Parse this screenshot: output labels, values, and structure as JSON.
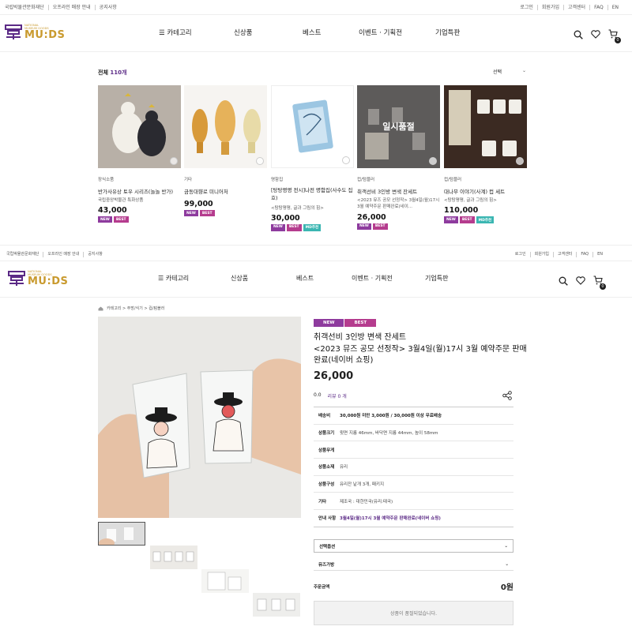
{
  "top": {
    "util_left": [
      "국립박물관문화재단",
      "오프라인 매장 안내",
      "공지사항"
    ],
    "util_right": [
      "로그인",
      "회원가입",
      "고객센터",
      "FAQ",
      "EN"
    ],
    "logo_small": [
      "NATIONAL",
      "MUSEUM GOODS"
    ],
    "logo_big": "MU:DS",
    "nav": [
      "카테고리",
      "신상품",
      "베스트",
      "이벤트 · 기획전",
      "기업특판"
    ],
    "cart_count": "0"
  },
  "listing": {
    "total_prefix": "전체",
    "total_count": "110개",
    "sort_label": "선택",
    "soldout_overlay": "일시품절",
    "products": [
      {
        "category": "장식소품",
        "name": "반가사유상 토우 시리즈(놀놀 반가)",
        "sub": "국립중앙박물관 특화상품",
        "price": "43,000",
        "tags": [
          "NEW",
          "BEST"
        ]
      },
      {
        "category": "기타",
        "name": "금동대향로 미니어처",
        "sub": "",
        "price": "99,000",
        "tags": [
          "NEW",
          "BEST"
        ]
      },
      {
        "category": "명함집",
        "name": "[탕탕평평 전시]나전 명함집(사수도 집호)",
        "sub": "<탕탕평평, 글과 그림의 힘>",
        "price": "30,000",
        "tags": [
          "NEW",
          "BEST",
          "MD추천"
        ]
      },
      {
        "category": "컵/텀블러",
        "name": "취객선비 3인방 변색 잔세트",
        "sub": "<2023 뮤즈 공모 선정작> 3월4일(월)17시 3월 예약주문 판매완료(네이...",
        "price": "26,000",
        "tags": [
          "NEW",
          "BEST"
        ]
      },
      {
        "category": "컵/텀블러",
        "name": "대나무 이야기(사계) 컵 세트",
        "sub": "<탕탕평평, 글과 그림의 힘>",
        "price": "110,000",
        "tags": [
          "NEW",
          "BEST",
          "MD추천"
        ]
      }
    ]
  },
  "detail": {
    "breadcrumb": "카테고리 > 주방/식기 > 컵/텀블러",
    "tags": [
      "NEW",
      "BEST"
    ],
    "title_line1": "취객선비 3인방 변색 잔세트",
    "title_line2": "<2023 뮤즈 공모 선정작> 3월4일(월)17시 3월 예약주문 판매",
    "title_line3": "완료(네이버 쇼핑)",
    "price": "26,000",
    "rating": "0.0",
    "reviews_label": "리뷰 0 개",
    "info": [
      {
        "k": "배송비",
        "v": "30,000원 미만 3,000원 / 30,000원 이상 무료배송"
      },
      {
        "k": "상품크기",
        "v": "윗면 지름 46mm, 바닥면 지름 44mm, 높이 58mm"
      },
      {
        "k": "상품무게",
        "v": ""
      },
      {
        "k": "상품소재",
        "v": "유리"
      },
      {
        "k": "상품구성",
        "v": "유리잔 낱개 3개, 패키지"
      },
      {
        "k": "기타",
        "v": "제조국 : 대한민국(유리:태국)"
      },
      {
        "k": "안내 사항",
        "v": "3월4일(월)17시 3월 예약주문 판매완료(네이버 쇼핑)"
      }
    ],
    "select_option": "선택옵션",
    "bag_option": "뮤즈가방",
    "order_label": "주문금액",
    "order_total": "0원",
    "soldout_button": "상품이 품절되었습니다."
  },
  "colors": {
    "brand_gold": "#c99a2e",
    "brand_purple": "#5b2a86",
    "tag_new": "#8e3b9e",
    "tag_best": "#b53c8e",
    "tag_md": "#3bb6b2"
  }
}
